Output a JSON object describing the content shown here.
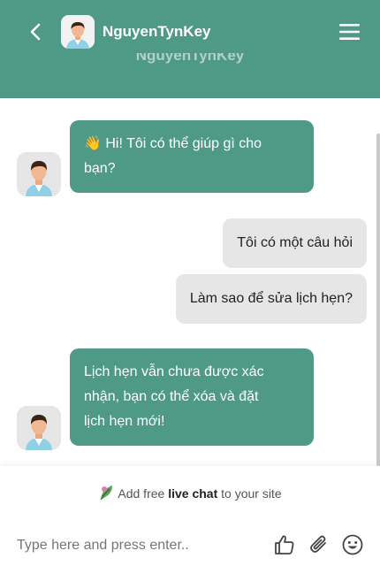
{
  "header": {
    "title": "NguyenTynKey",
    "subtitle": "NguyenTynKey",
    "color": "#4f9a87"
  },
  "messages": [
    {
      "sender": "bot",
      "lines": [
        "👋 Hi! Tôi có thể giúp gì cho",
        "bạn?"
      ]
    },
    {
      "sender": "user",
      "text": "Tôi có một câu hỏi"
    },
    {
      "sender": "user",
      "text": "Làm sao để sửa lịch hẹn?"
    },
    {
      "sender": "bot",
      "lines": [
        "Lịch hẹn vẫn chưa được xác",
        "nhận, bạn có thể xóa và đặt",
        "lịch hẹn mới!"
      ]
    }
  ],
  "footer": {
    "promo_prefix": "Add free ",
    "promo_bold": "live chat",
    "promo_suffix": " to your site",
    "input_placeholder": "Type here and press enter.."
  },
  "icons": {
    "back": "chevron-left-icon",
    "menu": "hamburger-menu-icon",
    "promo": "leaf-icon",
    "like": "thumbs-up-icon",
    "attach": "paperclip-icon",
    "emoji": "smiley-icon"
  }
}
